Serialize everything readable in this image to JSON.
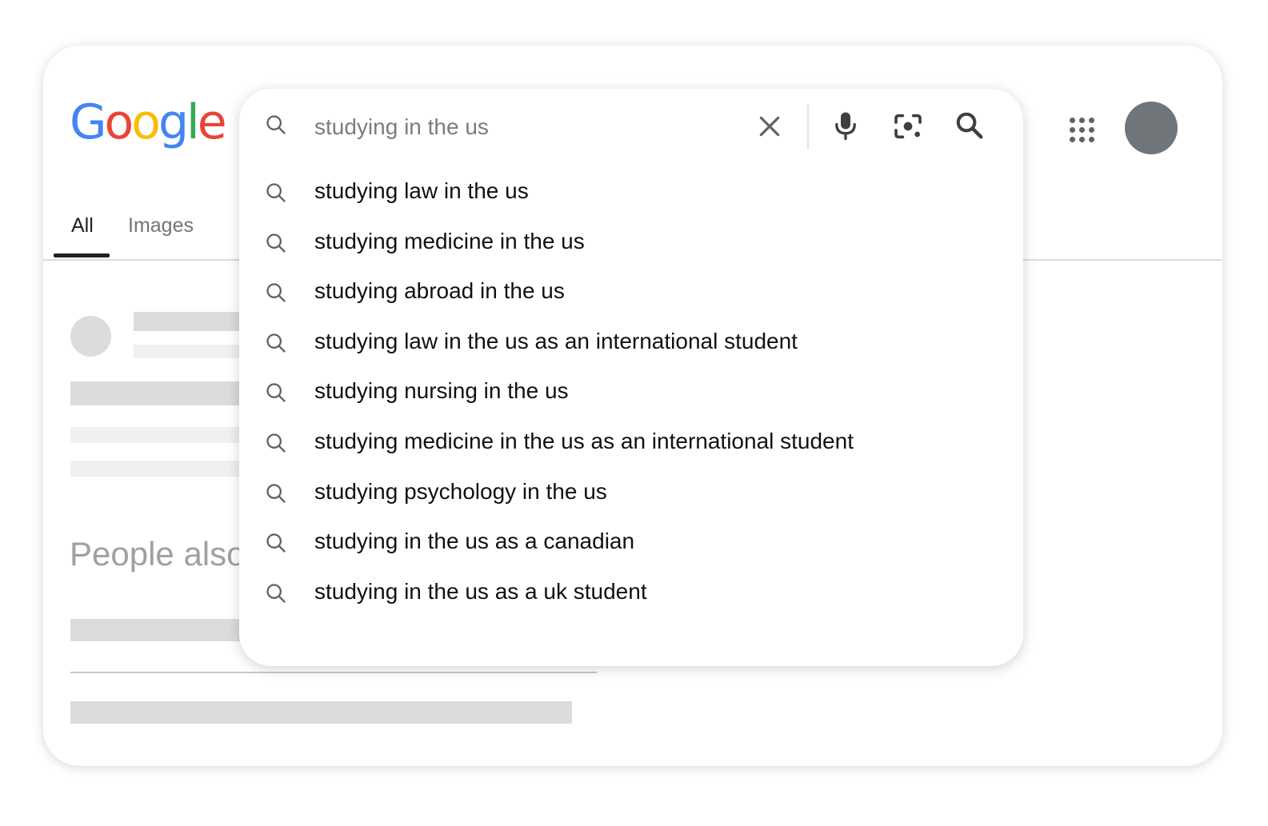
{
  "logo": {
    "text": "Google",
    "letters": [
      {
        "ch": "G",
        "color": "#4285F4"
      },
      {
        "ch": "o",
        "color": "#EA4335"
      },
      {
        "ch": "o",
        "color": "#FBBC05"
      },
      {
        "ch": "g",
        "color": "#4285F4"
      },
      {
        "ch": "l",
        "color": "#34A853"
      },
      {
        "ch": "e",
        "color": "#EA4335"
      }
    ]
  },
  "tabs": [
    {
      "label": "All",
      "active": true
    },
    {
      "label": "Images",
      "active": false
    }
  ],
  "search": {
    "value": "studying in the us"
  },
  "icons": {
    "search": "search-icon",
    "clear": "close-icon",
    "voice": "microphone-icon",
    "lens": "camera-lens-icon",
    "submit": "search-icon",
    "apps": "apps-grid-icon",
    "account": "avatar"
  },
  "suggestions": [
    "studying law in the us",
    "studying medicine in the us",
    "studying abroad in the us",
    "studying law in the us as an international student",
    "studying nursing in the us",
    "studying medicine in the us as an international student",
    "studying psychology in the us",
    "studying in the us as a canadian",
    "studying in the us as a uk student"
  ],
  "background": {
    "people_also": "People also"
  },
  "colors": {
    "text": "#111111",
    "muted": "#70757a",
    "icon": "#5f6368",
    "avatar": "#70757a"
  }
}
